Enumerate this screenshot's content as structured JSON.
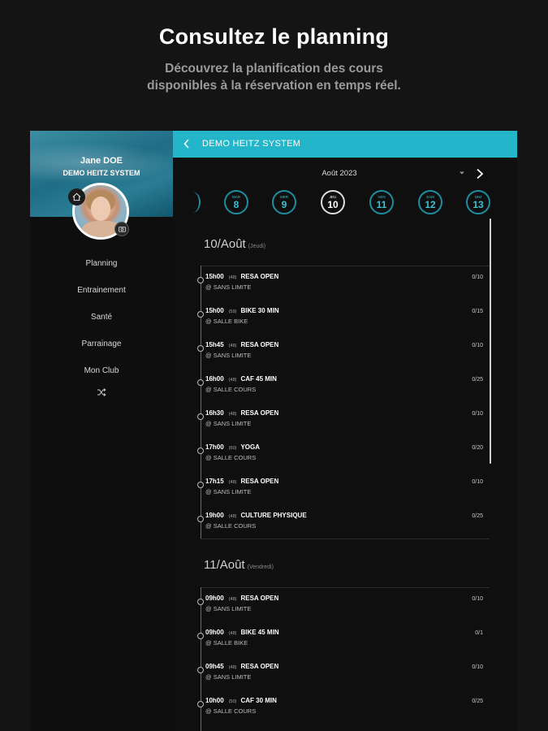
{
  "promo": {
    "title": "Consultez le planning",
    "subtitle_line1": "Découvrez la planification des cours",
    "subtitle_line2": "disponibles à la réservation en temps réel."
  },
  "sidebar": {
    "user_name": "Jane  DOE",
    "club_name": "DEMO HEITZ SYSTEM",
    "items": [
      {
        "label": "Planning"
      },
      {
        "label": "Entrainement"
      },
      {
        "label": "Santé"
      },
      {
        "label": "Parrainage"
      },
      {
        "label": "Mon Club"
      }
    ]
  },
  "topbar": {
    "title": "DEMO HEITZ SYSTEM"
  },
  "calendar": {
    "month": "Août 2023",
    "days": [
      {
        "weekday": "MAR",
        "date": "8",
        "selected": false
      },
      {
        "weekday": "MER",
        "date": "9",
        "selected": false
      },
      {
        "weekday": "JEU",
        "date": "10",
        "selected": true
      },
      {
        "weekday": "VEN",
        "date": "11",
        "selected": false
      },
      {
        "weekday": "SAM",
        "date": "12",
        "selected": false
      },
      {
        "weekday": "DIM",
        "date": "13",
        "selected": false
      }
    ]
  },
  "schedule": [
    {
      "heading": "10/Août",
      "weekday": "(Jeudi)",
      "slots": [
        {
          "time": "15h00",
          "code": "(48)",
          "name": "RESA OPEN",
          "room": "@ SANS LIMITE",
          "count": "0/10"
        },
        {
          "time": "15h00",
          "code": "(59)",
          "name": "BIKE 30 MIN",
          "room": "@ SALLE BIKE",
          "count": "0/15"
        },
        {
          "time": "15h45",
          "code": "(48)",
          "name": "RESA OPEN",
          "room": "@ SANS LIMITE",
          "count": "0/10"
        },
        {
          "time": "16h00",
          "code": "(48)",
          "name": "CAF 45 MIN",
          "room": "@ SALLE COURS",
          "count": "0/25"
        },
        {
          "time": "16h30",
          "code": "(48)",
          "name": "RESA OPEN",
          "room": "@ SANS LIMITE",
          "count": "0/10"
        },
        {
          "time": "17h00",
          "code": "(60)",
          "name": "YOGA",
          "room": "@ SALLE COURS",
          "count": "0/20"
        },
        {
          "time": "17h15",
          "code": "(48)",
          "name": "RESA OPEN",
          "room": "@ SANS LIMITE",
          "count": "0/10"
        },
        {
          "time": "19h00",
          "code": "(48)",
          "name": "CULTURE PHYSIQUE",
          "room": "@ SALLE COURS",
          "count": "0/25"
        }
      ]
    },
    {
      "heading": "11/Août",
      "weekday": "(Vendredi)",
      "slots": [
        {
          "time": "09h00",
          "code": "(48)",
          "name": "RESA OPEN",
          "room": "@ SANS LIMITE",
          "count": "0/10"
        },
        {
          "time": "09h00",
          "code": "(48)",
          "name": "BIKE 45 MIN",
          "room": "@ SALLE BIKE",
          "count": "0/1"
        },
        {
          "time": "09h45",
          "code": "(48)",
          "name": "RESA OPEN",
          "room": "@ SANS LIMITE",
          "count": "0/10"
        },
        {
          "time": "10h00",
          "code": "(50)",
          "name": "CAF 30 MIN",
          "room": "@ SALLE COURS",
          "count": "0/25"
        }
      ]
    }
  ],
  "colors": {
    "accent": "#23b5c9",
    "background": "#141414"
  },
  "icons": {
    "home": "home-icon",
    "camera": "camera-icon",
    "back": "chevron-left-icon",
    "next": "chevron-right-icon",
    "shuffle": "shuffle-icon"
  }
}
